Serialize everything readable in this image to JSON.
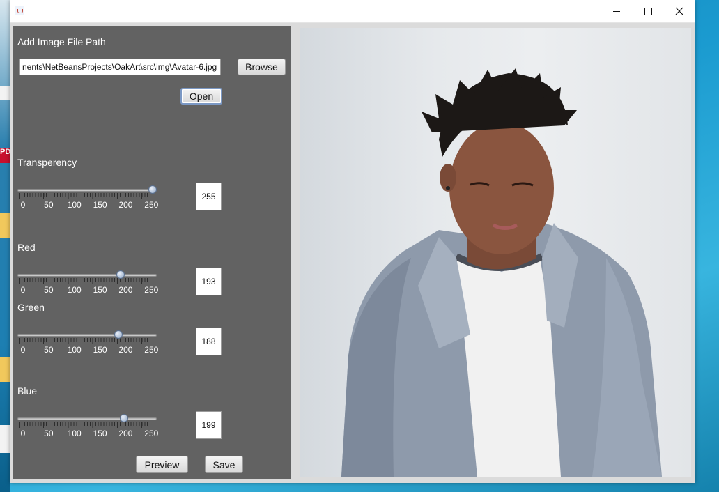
{
  "window": {
    "title": ""
  },
  "panel": {
    "file_path_label": "Add Image File Path",
    "file_path_value": "nents\\NetBeansProjects\\OakArt\\src\\img\\Avatar-6.jpg",
    "browse_label": "Browse",
    "open_label": "Open",
    "tick_labels": [
      "0",
      "50",
      "100",
      "150",
      "200",
      "250"
    ],
    "sliders": [
      {
        "name": "transperency",
        "label": "Transperency",
        "value": 255,
        "value_text": "255"
      },
      {
        "name": "red",
        "label": "Red",
        "value": 193,
        "value_text": "193"
      },
      {
        "name": "green",
        "label": "Green",
        "value": 188,
        "value_text": "188"
      },
      {
        "name": "blue",
        "label": "Blue",
        "value": 199,
        "value_text": "199"
      }
    ],
    "preview_label": "Preview",
    "save_label": "Save"
  },
  "desktop": {
    "pdf_badge": "PD"
  },
  "colors": {
    "panel_bg": "#626262",
    "window_bg": "#dbdbdb",
    "desktop": "#1b9bd0"
  }
}
